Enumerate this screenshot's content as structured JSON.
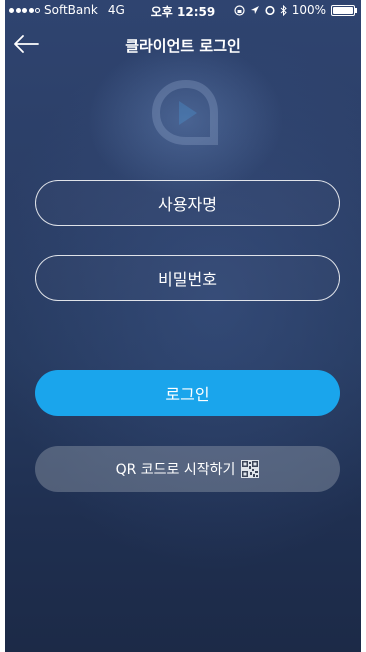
{
  "status_bar": {
    "carrier": "SoftBank",
    "network": "4G",
    "time": "오후 12:59",
    "battery": "100%"
  },
  "header": {
    "title": "클라이언트 로그인",
    "back_icon": "arrow-left-icon"
  },
  "form": {
    "username_placeholder": "사용자명",
    "password_placeholder": "비밀번호",
    "login_label": "로그인",
    "qr_label": "QR 코드로 시작하기"
  },
  "colors": {
    "accent": "#1aa5ec",
    "background": "#2b3e66"
  }
}
